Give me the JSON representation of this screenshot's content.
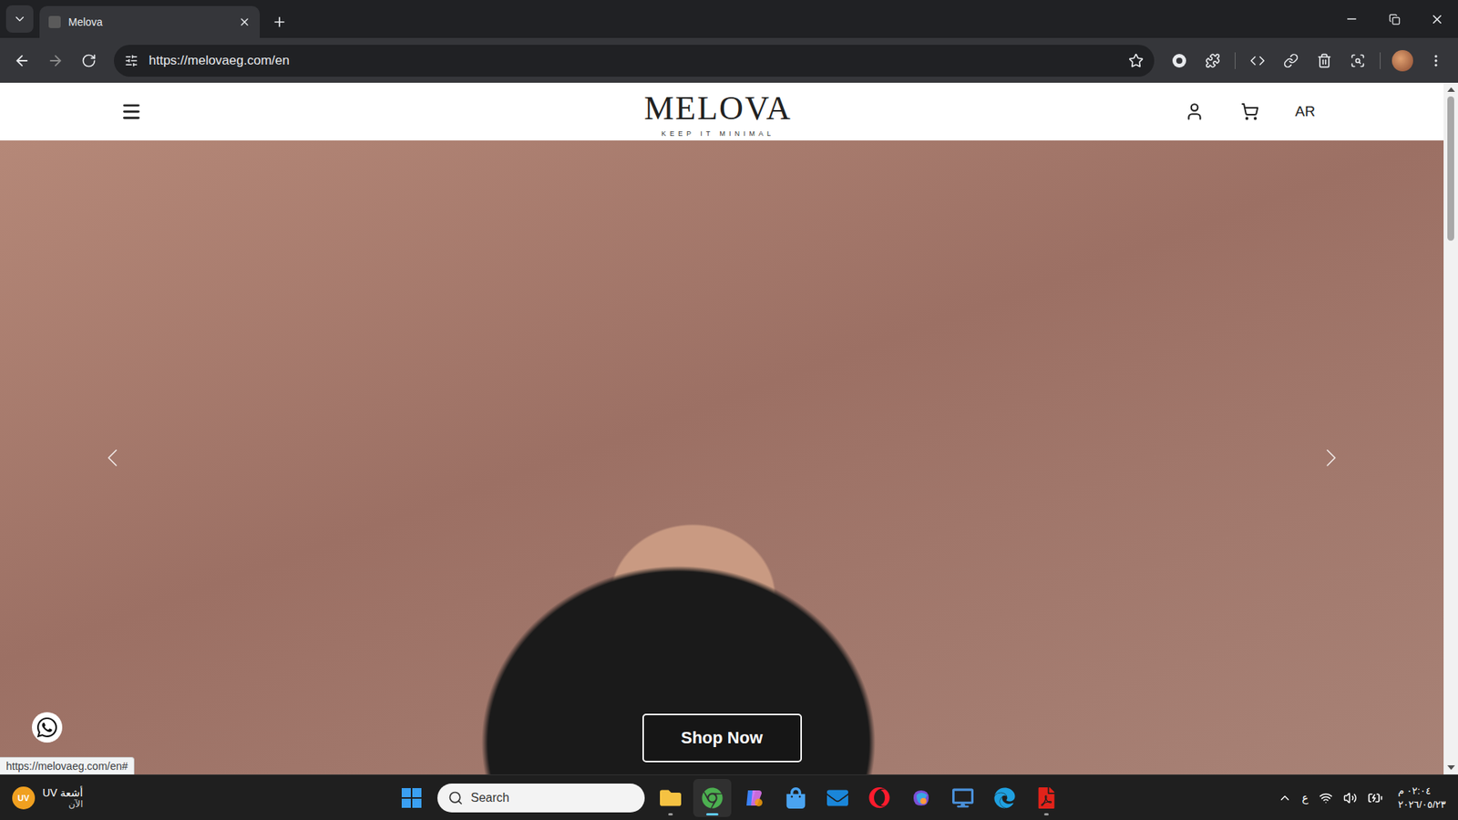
{
  "browser": {
    "tabs": [
      {
        "title": "Melova",
        "selected": true
      }
    ],
    "address": "https://melovaeg.com/en",
    "bookmarked": false
  },
  "site": {
    "header": {
      "logo": "MELOVA",
      "tagline": "KEEP IT MINIMAL",
      "language": "AR"
    },
    "hero": {
      "button": "Shop Now"
    },
    "status_url": "https://melovaeg.com/en#"
  },
  "taskbar": {
    "weather": {
      "badge": "UV",
      "title": "أشعة UV",
      "subtitle": "الآن"
    },
    "search": {
      "placeholder": "Search"
    },
    "apps": [
      {
        "kind": "explorer",
        "running": true,
        "active": false
      },
      {
        "kind": "chrome",
        "running": true,
        "active": true
      },
      {
        "kind": "copilot",
        "running": false,
        "active": false
      },
      {
        "kind": "store",
        "running": false,
        "active": false
      },
      {
        "kind": "outlook",
        "running": false,
        "active": false
      },
      {
        "kind": "opera",
        "running": false,
        "active": false
      },
      {
        "kind": "m365",
        "running": false,
        "active": false
      },
      {
        "kind": "remote",
        "running": false,
        "active": false
      },
      {
        "kind": "edge",
        "running": false,
        "active": false
      },
      {
        "kind": "acrobat",
        "running": true,
        "active": false
      }
    ],
    "tray": {
      "input_language": "ع",
      "time": "٠٢:٠٤ م",
      "date": "٢٠٢٦/٠٥/٢٣"
    }
  }
}
